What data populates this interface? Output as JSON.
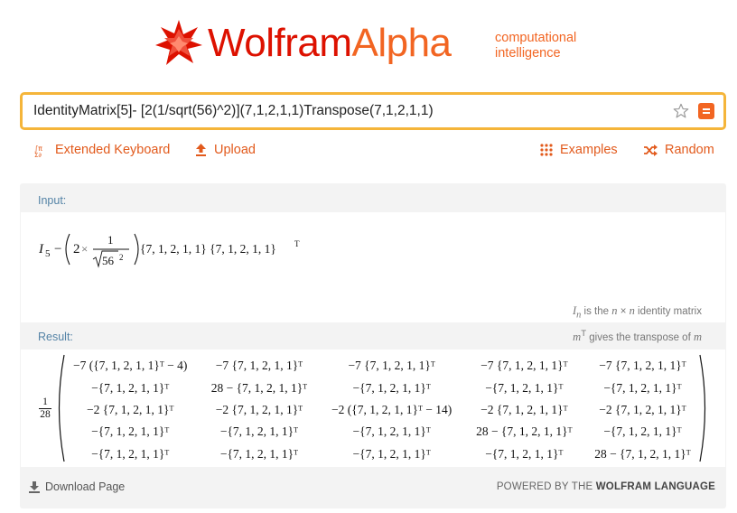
{
  "header": {
    "logo_part1": "Wolfram",
    "logo_part2": "Alpha",
    "tagline_line1": "computational",
    "tagline_line2": "intelligence"
  },
  "search": {
    "query": "IdentityMatrix[5]- [2(1/sqrt(56)^2)](7,1,2,1,1)Transpose(7,1,2,1,1)"
  },
  "toolbar": {
    "extended_keyboard": "Extended Keyboard",
    "upload": "Upload",
    "examples": "Examples",
    "random": "Random"
  },
  "input_pod": {
    "label": "Input:",
    "identity_note_rest": " is the n × n identity matrix",
    "transpose_note_rest": " gives the transpose of "
  },
  "result_pod": {
    "label": "Result:",
    "prefix_numerator": "1",
    "prefix_denominator": "28",
    "matrix": [
      [
        "−7 ({7, 1, 2, 1, 1}ᵀ − 4)",
        "−7 {7, 1, 2, 1, 1}ᵀ",
        "−7 {7, 1, 2, 1, 1}ᵀ",
        "−7 {7, 1, 2, 1, 1}ᵀ",
        "−7 {7, 1, 2, 1, 1}ᵀ"
      ],
      [
        "−{7, 1, 2, 1, 1}ᵀ",
        "28 − {7, 1, 2, 1, 1}ᵀ",
        "−{7, 1, 2, 1, 1}ᵀ",
        "−{7, 1, 2, 1, 1}ᵀ",
        "−{7, 1, 2, 1, 1}ᵀ"
      ],
      [
        "−2 {7, 1, 2, 1, 1}ᵀ",
        "−2 {7, 1, 2, 1, 1}ᵀ",
        "−2 ({7, 1, 2, 1, 1}ᵀ − 14)",
        "−2 {7, 1, 2, 1, 1}ᵀ",
        "−2 {7, 1, 2, 1, 1}ᵀ"
      ],
      [
        "−{7, 1, 2, 1, 1}ᵀ",
        "−{7, 1, 2, 1, 1}ᵀ",
        "−{7, 1, 2, 1, 1}ᵀ",
        "28 − {7, 1, 2, 1, 1}ᵀ",
        "−{7, 1, 2, 1, 1}ᵀ"
      ],
      [
        "−{7, 1, 2, 1, 1}ᵀ",
        "−{7, 1, 2, 1, 1}ᵀ",
        "−{7, 1, 2, 1, 1}ᵀ",
        "−{7, 1, 2, 1, 1}ᵀ",
        "28 − {7, 1, 2, 1, 1}ᵀ"
      ]
    ]
  },
  "footer": {
    "download": "Download Page",
    "powered_prefix": "POWERED BY THE ",
    "powered_brand": "WOLFRAM LANGUAGE"
  },
  "colors": {
    "brand_red": "#dd1100",
    "brand_orange": "#f26522",
    "search_border": "#f5b53a",
    "pod_label": "#5483a6"
  }
}
